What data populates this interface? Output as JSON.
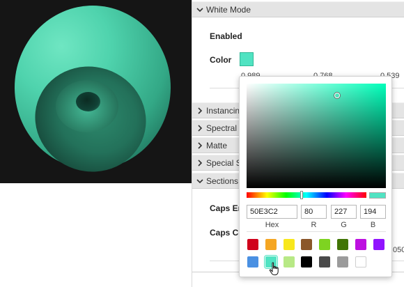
{
  "panel": {
    "white_mode": {
      "title": "White Mode"
    },
    "enabled_label": "Enabled",
    "color_label": "Color",
    "color_value": "#50E3C2",
    "numbers": [
      "0.989",
      "0.768",
      "0.539"
    ],
    "sections": [
      {
        "id": "instancing",
        "label": "Instancing"
      },
      {
        "id": "spectral",
        "label": "Spectral"
      },
      {
        "id": "matte",
        "label": "Matte"
      },
      {
        "id": "special",
        "label": "Special S"
      }
    ],
    "sections_header": {
      "title": "Sections"
    },
    "caps_enabled_label": "Caps Er",
    "caps_color_label": "Caps Co",
    "trailing_number": "050"
  },
  "picker": {
    "hex": "50E3C2",
    "r": "80",
    "g": "227",
    "b": "194",
    "hex_label": "Hex",
    "r_label": "R",
    "g_label": "G",
    "b_label": "B",
    "current_color": "#50E3C2",
    "hue_color": "#00ffba",
    "saturation": 0.65,
    "value": 0.89,
    "hue_fraction": 0.46,
    "presets": [
      [
        "#d0021b",
        "#f5a623",
        "#f8e71c",
        "#8b572a",
        "#7ed321",
        "#417505",
        "#bd10e0",
        "#9013fe"
      ],
      [
        "#4a90e2",
        "#50e3c2",
        "#b8e986",
        "#000000",
        "#4a4a4a",
        "#9b9b9b",
        "#ffffff"
      ]
    ],
    "selected_preset": "#50e3c2"
  },
  "icons": {
    "chevron_down": "chevron-down-icon",
    "chevron_right": "chevron-right-icon",
    "cursor": "hand-pointer-icon"
  }
}
